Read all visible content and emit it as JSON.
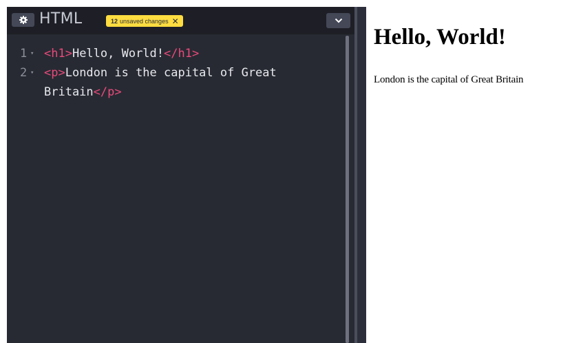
{
  "editor": {
    "title": "HTML",
    "unsaved_count": "12",
    "unsaved_label": "unsaved changes",
    "unsaved_close": "✕",
    "settings_icon": "gear-icon",
    "collapse_icon": "chevron-down-icon",
    "lines": [
      {
        "number": "1",
        "parts": [
          {
            "text": "<h1>",
            "kind": "tag"
          },
          {
            "text": "Hello, World!",
            "kind": "text"
          },
          {
            "text": "</h1>",
            "kind": "tag"
          }
        ]
      },
      {
        "number": "2",
        "parts": [
          {
            "text": "<p>",
            "kind": "tag"
          },
          {
            "text": "London is the capital of Great",
            "kind": "text"
          }
        ]
      },
      {
        "number": "",
        "parts": [
          {
            "text": "Britain",
            "kind": "text"
          },
          {
            "text": "</p>",
            "kind": "tag"
          }
        ]
      }
    ]
  },
  "preview": {
    "heading": "Hello, World!",
    "paragraph": "London is the capital of Great Britain"
  },
  "colors": {
    "editor_bg": "#282a33",
    "header_bg": "#1e1f26",
    "tag": "#e84a7a",
    "code_text": "#e8e9ee",
    "badge": "#ffdd40"
  }
}
